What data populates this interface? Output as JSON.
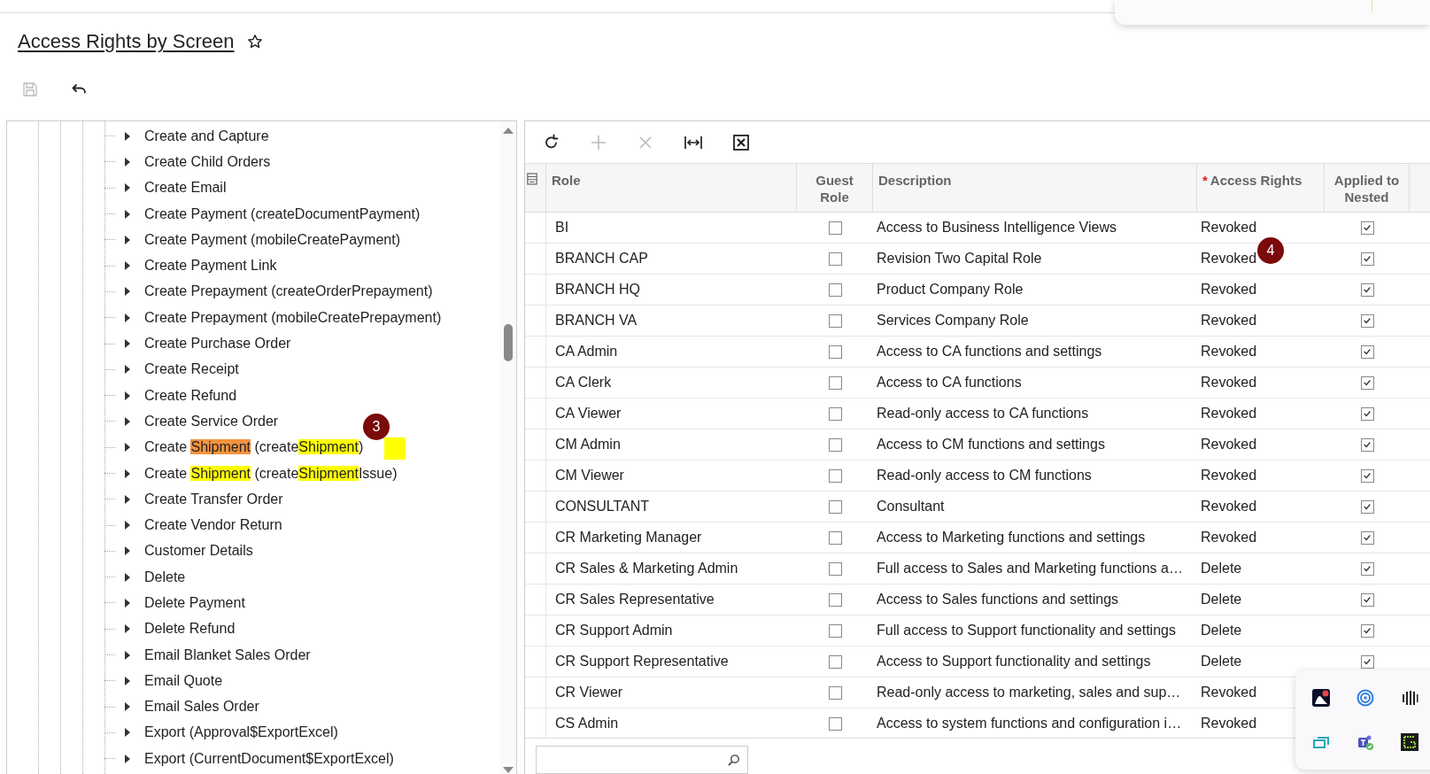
{
  "page": {
    "title": "Access Rights by Screen",
    "favorite": false
  },
  "toolbar": [
    {
      "kind": "save",
      "disabled": true
    },
    {
      "kind": "undo",
      "disabled": false
    }
  ],
  "tree": {
    "items": [
      {
        "segments": [
          {
            "text": "Create and Capture"
          }
        ],
        "expanded": false
      },
      {
        "segments": [
          {
            "text": "Create Child Orders"
          }
        ],
        "expanded": false
      },
      {
        "segments": [
          {
            "text": "Create Email"
          }
        ],
        "expanded": false
      },
      {
        "segments": [
          {
            "text": "Create Payment (createDocumentPayment)"
          }
        ],
        "expanded": false
      },
      {
        "segments": [
          {
            "text": "Create Payment (mobileCreatePayment)"
          }
        ],
        "expanded": false
      },
      {
        "segments": [
          {
            "text": "Create Payment Link"
          }
        ],
        "expanded": false
      },
      {
        "segments": [
          {
            "text": "Create Prepayment (createOrderPrepayment)"
          }
        ],
        "expanded": false
      },
      {
        "segments": [
          {
            "text": "Create Prepayment (mobileCreatePrepayment)"
          }
        ],
        "expanded": false
      },
      {
        "segments": [
          {
            "text": "Create Purchase Order"
          }
        ],
        "expanded": false
      },
      {
        "segments": [
          {
            "text": "Create Receipt"
          }
        ],
        "expanded": false
      },
      {
        "segments": [
          {
            "text": "Create Refund"
          }
        ],
        "expanded": false
      },
      {
        "segments": [
          {
            "text": "Create Service Order"
          }
        ],
        "expanded": false
      },
      {
        "segments": [
          {
            "text": "Create ",
            "highlighted": false
          },
          {
            "text": "Shipment",
            "highlighted": true,
            "current": true
          },
          {
            "text": " (create",
            "highlighted": false
          },
          {
            "text": "Shipment",
            "highlighted": true,
            "current": false
          },
          {
            "text": ")",
            "highlighted": false
          }
        ],
        "expanded": false,
        "marker": "3"
      },
      {
        "segments": [
          {
            "text": "Create ",
            "highlighted": false
          },
          {
            "text": "Shipment",
            "highlighted": true,
            "current": false
          },
          {
            "text": " (create",
            "highlighted": false
          },
          {
            "text": "Shipment",
            "highlighted": true,
            "current": false
          },
          {
            "text": "Issue)",
            "highlighted": false
          }
        ],
        "expanded": false
      },
      {
        "segments": [
          {
            "text": "Create Transfer Order"
          }
        ],
        "expanded": false
      },
      {
        "segments": [
          {
            "text": "Create Vendor Return"
          }
        ],
        "expanded": false
      },
      {
        "segments": [
          {
            "text": "Customer Details"
          }
        ],
        "expanded": false
      },
      {
        "segments": [
          {
            "text": "Delete"
          }
        ],
        "expanded": false
      },
      {
        "segments": [
          {
            "text": "Delete Payment"
          }
        ],
        "expanded": false
      },
      {
        "segments": [
          {
            "text": "Delete Refund"
          }
        ],
        "expanded": false
      },
      {
        "segments": [
          {
            "text": "Email Blanket Sales Order"
          }
        ],
        "expanded": false
      },
      {
        "segments": [
          {
            "text": "Email Quote"
          }
        ],
        "expanded": false
      },
      {
        "segments": [
          {
            "text": "Email Sales Order"
          }
        ],
        "expanded": false
      },
      {
        "segments": [
          {
            "text": "Export (Approval$ExportExcel)"
          }
        ],
        "expanded": false
      },
      {
        "segments": [
          {
            "text": "Export (CurrentDocument$ExportExcel)"
          }
        ],
        "expanded": false
      }
    ]
  },
  "grid": {
    "toolbar": [
      {
        "kind": "refresh",
        "disabled": false
      },
      {
        "kind": "add",
        "disabled": true
      },
      {
        "kind": "delete",
        "disabled": true
      },
      {
        "kind": "fit",
        "disabled": false
      },
      {
        "kind": "excel",
        "disabled": false
      }
    ],
    "columns": [
      {
        "label": "Role"
      },
      {
        "label": "Guest Role"
      },
      {
        "label": "Description"
      },
      {
        "label": "Access Rights",
        "required_mark": "*"
      },
      {
        "label": "Applied to Nested"
      }
    ],
    "rows": [
      {
        "role": "BI",
        "guest_role": false,
        "description": "Access to Business Intelligence Views",
        "access_rights": "Revoked",
        "applied_to_nested": true
      },
      {
        "role": "BRANCH CAP",
        "guest_role": false,
        "description": "Revision Two Capital Role",
        "access_rights": "Revoked",
        "applied_to_nested": true,
        "marker": "4"
      },
      {
        "role": "BRANCH HQ",
        "guest_role": false,
        "description": "Product Company Role",
        "access_rights": "Revoked",
        "applied_to_nested": true
      },
      {
        "role": "BRANCH VA",
        "guest_role": false,
        "description": "Services Company Role",
        "access_rights": "Revoked",
        "applied_to_nested": true
      },
      {
        "role": "CA Admin",
        "guest_role": false,
        "description": "Access to CA functions and settings",
        "access_rights": "Revoked",
        "applied_to_nested": true
      },
      {
        "role": "CA Clerk",
        "guest_role": false,
        "description": "Access to CA functions",
        "access_rights": "Revoked",
        "applied_to_nested": true
      },
      {
        "role": "CA Viewer",
        "guest_role": false,
        "description": "Read-only access to CA functions",
        "access_rights": "Revoked",
        "applied_to_nested": true
      },
      {
        "role": "CM Admin",
        "guest_role": false,
        "description": "Access to CM functions and settings",
        "access_rights": "Revoked",
        "applied_to_nested": true
      },
      {
        "role": "CM Viewer",
        "guest_role": false,
        "description": "Read-only access to CM functions",
        "access_rights": "Revoked",
        "applied_to_nested": true
      },
      {
        "role": "CONSULTANT",
        "guest_role": false,
        "description": "Consultant",
        "access_rights": "Revoked",
        "applied_to_nested": true
      },
      {
        "role": "CR Marketing Manager",
        "guest_role": false,
        "description": "Access to Marketing functions and settings",
        "access_rights": "Revoked",
        "applied_to_nested": true
      },
      {
        "role": "CR Sales & Marketing Admin",
        "guest_role": false,
        "description": "Full access to Sales and Marketing functions a…",
        "access_rights": "Delete",
        "applied_to_nested": true
      },
      {
        "role": "CR Sales Representative",
        "guest_role": false,
        "description": "Access to Sales functions and settings",
        "access_rights": "Delete",
        "applied_to_nested": true
      },
      {
        "role": "CR Support Admin",
        "guest_role": false,
        "description": "Full access to Support functionality and settings",
        "access_rights": "Delete",
        "applied_to_nested": true
      },
      {
        "role": "CR Support Representative",
        "guest_role": false,
        "description": "Access to Support functionality and settings",
        "access_rights": "Delete",
        "applied_to_nested": true
      },
      {
        "role": "CR Viewer",
        "guest_role": false,
        "description": "Read-only access to marketing, sales and sup…",
        "access_rights": "Revoked"
      },
      {
        "role": "CS Admin",
        "guest_role": false,
        "description": "Access to system functions and configuration i…",
        "access_rights": "Revoked"
      }
    ]
  },
  "tray": [
    {
      "kind": "red-app"
    },
    {
      "kind": "rings"
    },
    {
      "kind": "bars"
    },
    {
      "kind": "windows"
    },
    {
      "kind": "teams"
    },
    {
      "kind": "green"
    }
  ]
}
